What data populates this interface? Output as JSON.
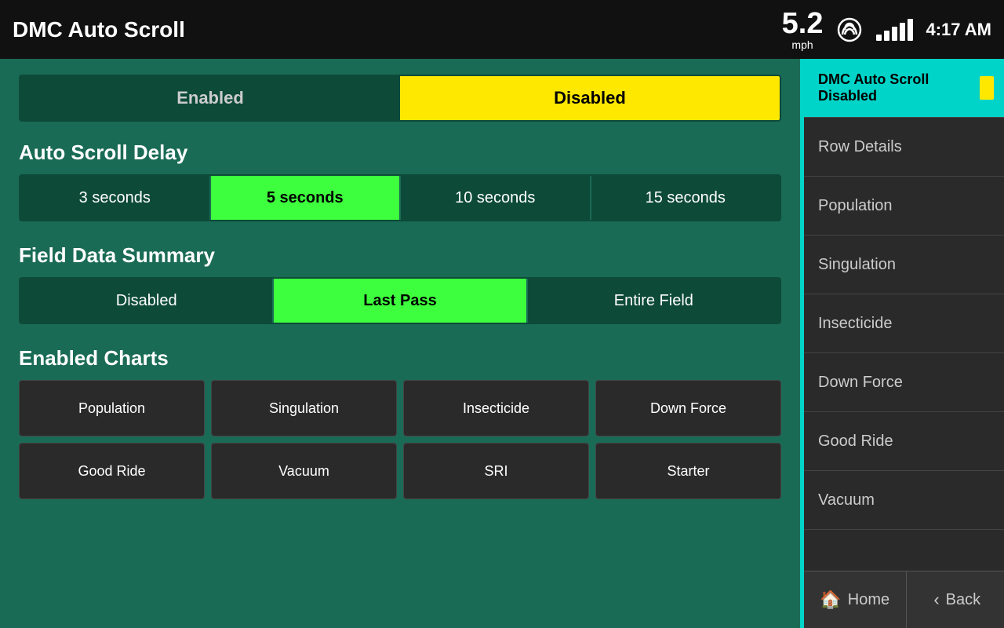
{
  "topbar": {
    "title": "DMC Auto Scroll",
    "speed": "5.2",
    "speed_unit": "mph",
    "time": "4:17 AM"
  },
  "toggle": {
    "enabled_label": "Enabled",
    "disabled_label": "Disabled",
    "active": "disabled"
  },
  "auto_scroll_delay": {
    "heading": "Auto Scroll Delay",
    "options": [
      "3 seconds",
      "5 seconds",
      "10 seconds",
      "15 seconds"
    ],
    "active_index": 1
  },
  "field_data_summary": {
    "heading": "Field Data Summary",
    "options": [
      "Disabled",
      "Last Pass",
      "Entire Field"
    ],
    "active_index": 1
  },
  "enabled_charts": {
    "heading": "Enabled Charts",
    "items": [
      "Population",
      "Singulation",
      "Insecticide",
      "Down Force",
      "Good Ride",
      "Vacuum",
      "SRI",
      "Starter"
    ]
  },
  "sidebar": {
    "active_item": "DMC Auto Scroll Disabled",
    "items": [
      {
        "label": "DMC Auto Scroll\nDisabled",
        "active": true
      },
      {
        "label": "Row Details",
        "active": false
      },
      {
        "label": "Population",
        "active": false
      },
      {
        "label": "Singulation",
        "active": false
      },
      {
        "label": "Insecticide",
        "active": false
      },
      {
        "label": "Down Force",
        "active": false
      },
      {
        "label": "Good Ride",
        "active": false
      },
      {
        "label": "Vacuum",
        "active": false
      }
    ],
    "home_label": "Home",
    "back_label": "Back"
  }
}
